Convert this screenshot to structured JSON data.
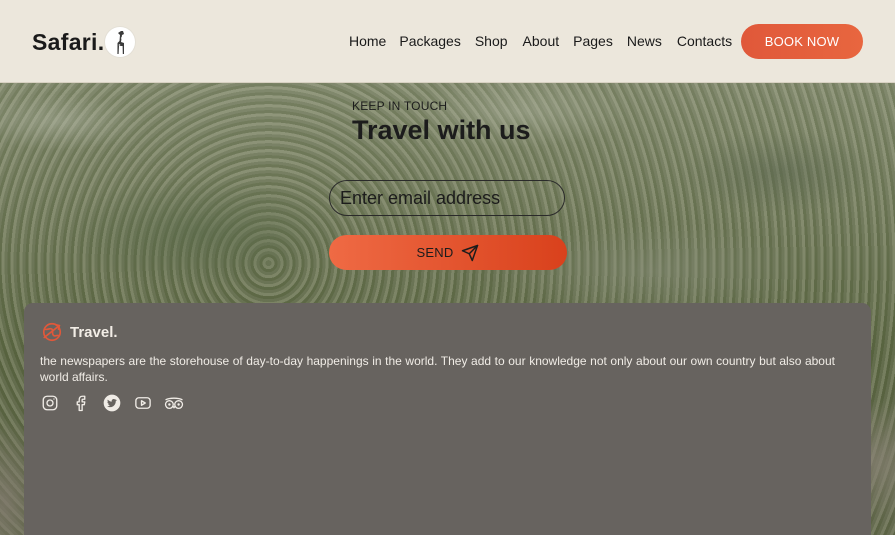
{
  "header": {
    "logo_text": "Safari.",
    "logo_icon": "giraffe-icon",
    "nav": [
      "Home",
      "Packages",
      "Shop",
      "About",
      "Pages",
      "News",
      "Contacts"
    ],
    "cta_label": "BOOK NOW"
  },
  "newsletter": {
    "kicker": "KEEP IN TOUCH",
    "heading": "Travel with us",
    "email_placeholder": "Enter email address",
    "send_label": "SEND",
    "send_icon": "send-icon"
  },
  "footer": {
    "brand_name": "Travel.",
    "brand_icon": "globe-plane-icon",
    "description": "the newspapers are the storehouse of day-to-day happenings in the world. They add to our knowledge not only about our own country but also about world affairs.",
    "socials": [
      "instagram-icon",
      "facebook-icon",
      "twitter-icon",
      "youtube-icon",
      "tripadvisor-icon"
    ]
  },
  "colors": {
    "header_bg": "#ece7dc",
    "accent": "#e0583a",
    "footer_card_bg": "#67635f"
  }
}
